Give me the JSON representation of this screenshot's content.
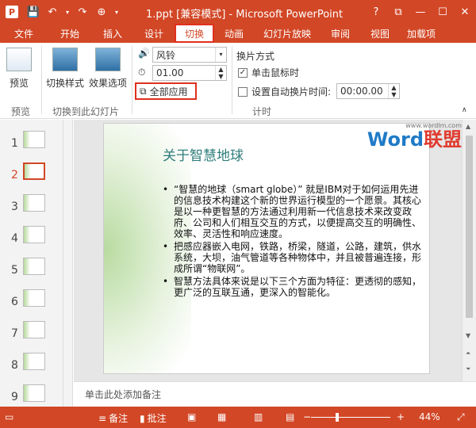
{
  "titlebar": {
    "app_icon": "P",
    "title": "1.ppt [兼容模式] - Microsoft PowerPoint",
    "help": "?",
    "restore": "⧉",
    "minimize": "—",
    "maximize": "☐",
    "close": "✕"
  },
  "tabs": [
    "文件",
    "开始",
    "插入",
    "设计",
    "切换",
    "动画",
    "幻灯片放映",
    "审阅",
    "视图",
    "加载项"
  ],
  "ribbon": {
    "preview_label": "预览",
    "preview_group": "预览",
    "transition_style_label": "切换样式",
    "effect_options_label": "效果选项",
    "transition_group": "切换到此幻灯片",
    "sound_value": "风铃",
    "duration_value": "01.00",
    "apply_all_label": "全部应用",
    "switch_mode_label": "换片方式",
    "on_click_label": "单击鼠标时",
    "auto_after_label": "设置自动换片时间:",
    "auto_time_value": "00:00.00",
    "timing_group": "计时"
  },
  "thumbs": [
    "1",
    "2",
    "3",
    "4",
    "5",
    "6",
    "7",
    "8",
    "9"
  ],
  "slide": {
    "title": "关于智慧地球",
    "bullets": [
      "“智慧的地球（smart globe）” 就是IBM对于如何运用先进的信息技术构建这个新的世界运行模型的一个愿景。其核心是以一种更智慧的方法通过利用新一代信息技术来改变政府、公司和人们相互交互的方式，以便提高交互的明确性、效率、灵活性和响应速度。",
      "把感应器嵌入电网，铁路，桥梁，隧道，公路，建筑，供水系统，大坝，油气管道等各种物体中，并且被普遍连接，形成所谓“物联网”。",
      "智慧方法具体来说是以下三个方面为特征：更透彻的感知，更广泛的互联互通，更深入的智能化。"
    ]
  },
  "watermark": {
    "url": "www.wordlm.com",
    "word": "Word",
    "cn": "联盟"
  },
  "notes_placeholder": "单击此处添加备注",
  "status": {
    "notes_label": "备注",
    "comments_label": "批注",
    "zoom": "44%"
  },
  "colors": {
    "accent": "#d24726",
    "highlight": "#e0301e",
    "slide_title": "#2e7d7a"
  }
}
